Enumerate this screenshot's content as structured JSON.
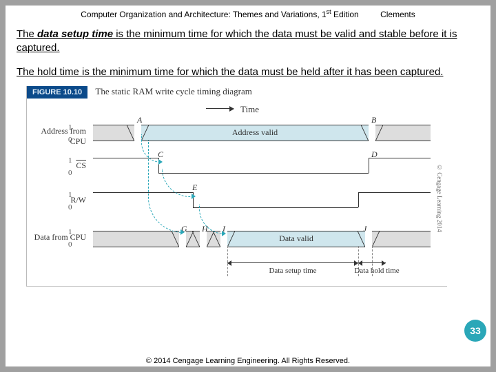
{
  "header": {
    "title_pre": "Computer Organization and Architecture: Themes and Variations, 1",
    "title_sup": "st",
    "title_post": " Edition",
    "author": "Clements"
  },
  "paragraphs": {
    "p1_prefix": "The ",
    "p1_term": "data setup time",
    "p1_rest": " is the minimum time for which the data must be valid and stable before it is captured.",
    "p2": "The hold time is the minimum time for which the data must be held after it has been captured."
  },
  "figure": {
    "label": "FIGURE 10.10",
    "caption": "The static RAM write cycle timing diagram",
    "time_axis": "Time",
    "signals": {
      "addr_label": "Address from CPU",
      "cs_label": "CS",
      "rw_label": "R/W",
      "data_label": "Data from CPU",
      "hi": "1",
      "lo": "0"
    },
    "bus_text": {
      "addr_valid": "Address valid",
      "data_valid": "Data valid"
    },
    "points": {
      "A": "A",
      "B": "B",
      "C": "C",
      "D": "D",
      "E": "E",
      "G": "G",
      "H": "H",
      "I": "I",
      "J": "J"
    },
    "dims": {
      "setup": "Data setup time",
      "hold": "Data hold time"
    },
    "side_copyright": "© Cengage Learning 2014"
  },
  "footer": "© 2014 Cengage Learning Engineering. All Rights Reserved.",
  "page_number": "33"
}
